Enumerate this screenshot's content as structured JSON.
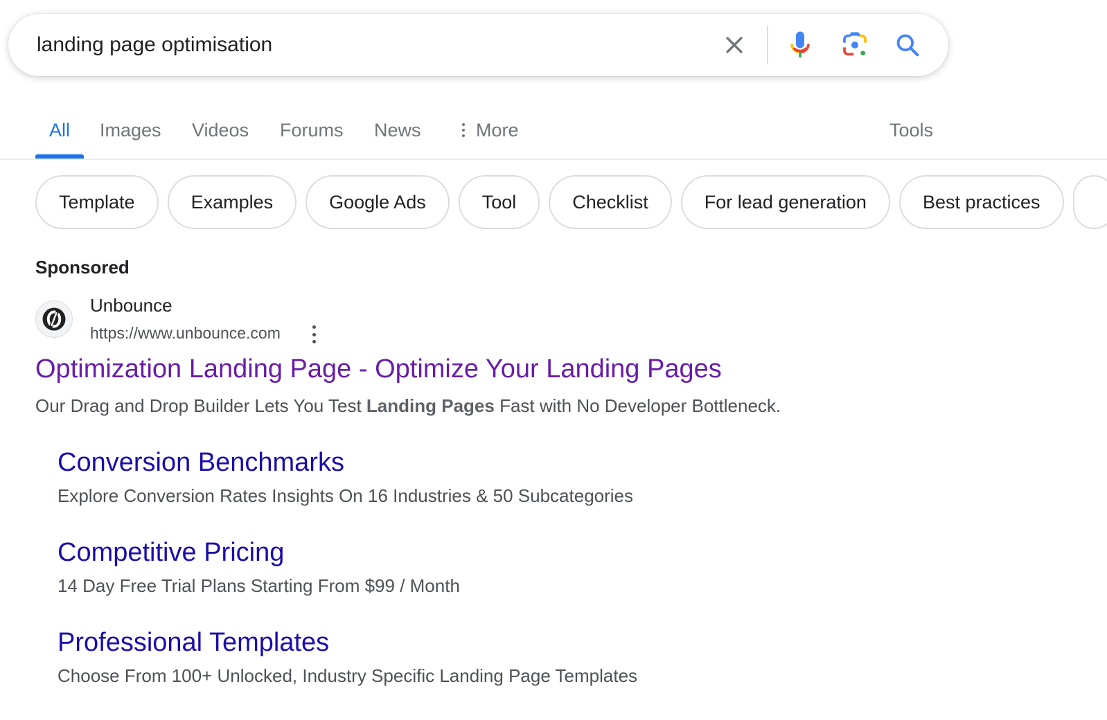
{
  "search": {
    "query": "landing page optimisation",
    "clear_icon": "close-icon",
    "voice_icon": "microphone-icon",
    "lens_icon": "google-lens-icon",
    "search_icon": "search-icon"
  },
  "tabs": {
    "items": [
      {
        "label": "All",
        "active": true
      },
      {
        "label": "Images",
        "active": false
      },
      {
        "label": "Videos",
        "active": false
      },
      {
        "label": "Forums",
        "active": false
      },
      {
        "label": "News",
        "active": false
      },
      {
        "label": "More",
        "active": false,
        "icon": "more-vert-icon"
      }
    ],
    "tools_label": "Tools",
    "accent_color": "#1a73e8"
  },
  "chips": [
    "Template",
    "Examples",
    "Google Ads",
    "Tool",
    "Checklist",
    "For lead generation",
    "Best practices"
  ],
  "ad": {
    "sponsored_label": "Sponsored",
    "advertiser": "Unbounce",
    "display_url": "https://www.unbounce.com",
    "title": "Optimization Landing Page - Optimize Your Landing Pages",
    "title_color": "#681da8",
    "description_before": "Our Drag and Drop Builder Lets You Test ",
    "description_bold": "Landing Pages",
    "description_after": " Fast with No Developer Bottleneck.",
    "sitelinks": [
      {
        "title": "Conversion Benchmarks",
        "description": "Explore Conversion Rates Insights On 16 Industries & 50 Subcategories"
      },
      {
        "title": "Competitive Pricing",
        "description": "14 Day Free Trial Plans Starting From $99 / Month"
      },
      {
        "title": "Professional Templates",
        "description": "Choose From 100+ Unlocked, Industry Specific Landing Page Templates"
      }
    ],
    "sitelink_color": "#1a0dab"
  }
}
